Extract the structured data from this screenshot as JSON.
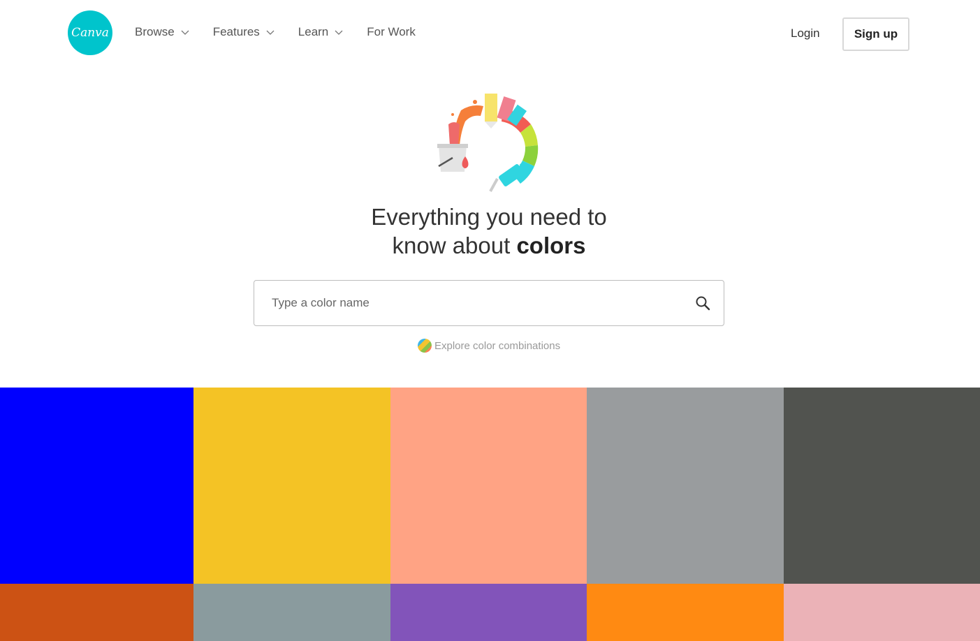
{
  "header": {
    "logo_text": "Canva",
    "nav": [
      {
        "label": "Browse",
        "has_dropdown": true
      },
      {
        "label": "Features",
        "has_dropdown": true
      },
      {
        "label": "Learn",
        "has_dropdown": true
      },
      {
        "label": "For Work",
        "has_dropdown": false
      }
    ],
    "login_label": "Login",
    "signup_label": "Sign up"
  },
  "hero": {
    "headline_line1": "Everything you need to",
    "headline_line2_prefix": "know about ",
    "headline_line2_bold": "colors"
  },
  "search": {
    "placeholder": "Type a color name",
    "value": ""
  },
  "explore_label": "Explore color combinations",
  "swatches": [
    {
      "color": "#0000ff"
    },
    {
      "color": "#f4c325"
    },
    {
      "color": "#ffa384"
    },
    {
      "color": "#999c9e"
    },
    {
      "color": "#51534f"
    },
    {
      "color": "#cc5214"
    },
    {
      "color": "#8a9b9e"
    },
    {
      "color": "#8254ba"
    },
    {
      "color": "#ff8a12"
    },
    {
      "color": "#ebb2b7"
    }
  ],
  "colors": {
    "brand": "#00c4cc"
  }
}
